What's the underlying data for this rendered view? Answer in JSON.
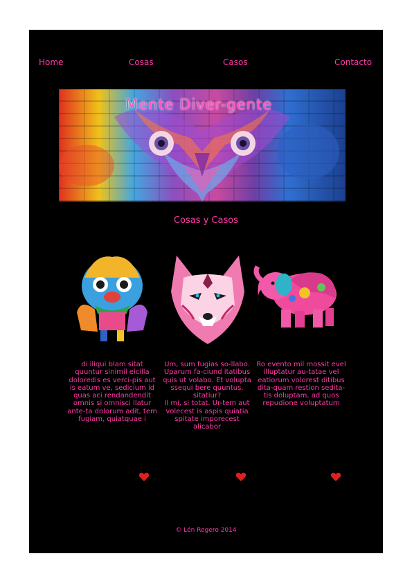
{
  "nav": {
    "items": [
      {
        "label": "Home"
      },
      {
        "label": "Cosas"
      },
      {
        "label": "Casos"
      },
      {
        "label": "Contacto"
      }
    ]
  },
  "banner": {
    "title": "Mente Diver-gente"
  },
  "section": {
    "title": "Cosas y Casos"
  },
  "cards": [
    {
      "image_icon": "lion-dance-illustration",
      "text": "di iliqui blam sitat quuntur sinimil eicilla doloredis es verci-pis aut is eatum ve, sedicium id quas aci rendandendit omnis si omnisci llatur ante-ta dolorum adit, tem fugiam, quiatquae i"
    },
    {
      "image_icon": "wolf-illustration",
      "text": "Um, sum fugias so-llabo. Uparum fa-ciund itatibus quis ut volabo. Et volupta ssequi bere quuntus, sitatiur?\nIl mi, si totat. Ur-tem aut volecest is aspis quiatia spitate imporecest alicabor"
    },
    {
      "image_icon": "elephant-illustration",
      "text": "Ro evento mil mossit evel illuptatur au-tatae vel eatiorum volorest ditibus dita-quam restion sedita-tis doluptam, ad quos repudione voluptatum"
    }
  ],
  "footer": {
    "copyright": "© Lén Regero 2014"
  },
  "colors": {
    "accent": "#ff3aa8",
    "background": "#000000",
    "page_background": "#ffffff",
    "heart": "#e0201c"
  }
}
